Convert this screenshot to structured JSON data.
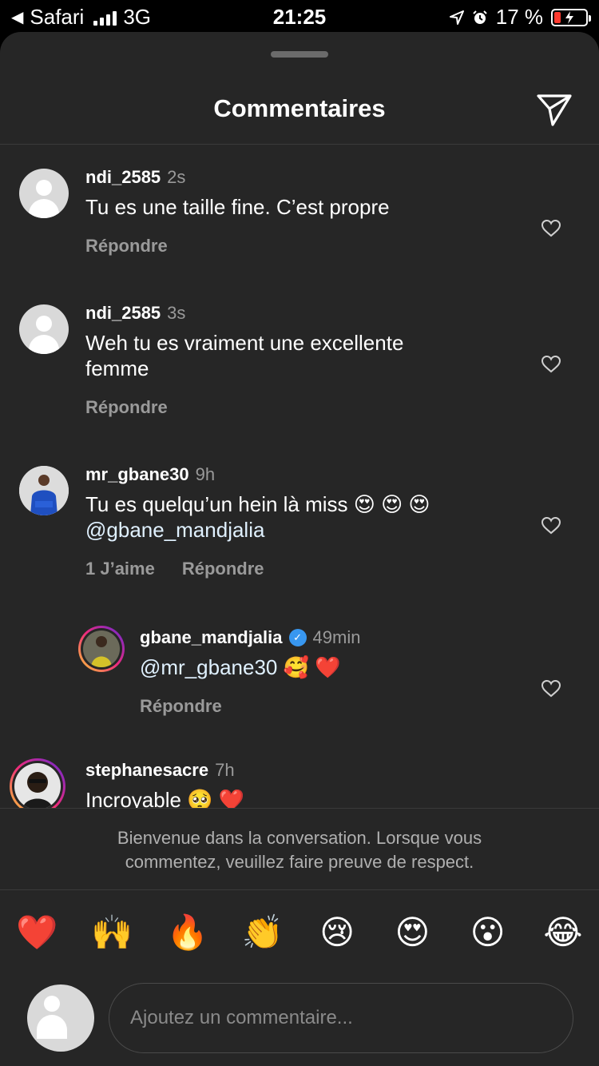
{
  "status_bar": {
    "back_app": "Safari",
    "network": "3G",
    "time": "21:25",
    "battery": "17 %"
  },
  "header": {
    "title": "Commentaires",
    "send_icon": "paper-plane-icon"
  },
  "comments": [
    {
      "username": "ndi_2585",
      "time": "2s",
      "text": "Tu es une taille fine. C’est propre",
      "reply": "Répondre",
      "avatar": "default"
    },
    {
      "username": "ndi_2585",
      "time": "3s",
      "text_lines": [
        "Weh tu es vraiment une excellente",
        "femme"
      ],
      "reply": "Répondre",
      "avatar": "default"
    },
    {
      "username": "mr_gbane30",
      "time": "9h",
      "text": "Tu es quelqu’un hein là miss 😍 😍 😍",
      "mention": "@gbane_mandjalia",
      "likes": "1 J’aime",
      "reply": "Répondre",
      "avatar": "photo"
    },
    {
      "username": "gbane_mandjalia",
      "time": "49min",
      "mention": "@mr_gbane30",
      "text_after": " 🥰 ❤️",
      "reply": "Répondre",
      "verified": true,
      "avatar": "photo"
    },
    {
      "username": "stephanesacre",
      "time": "7h",
      "text": "Incroyable 🥺 ❤️",
      "avatar": "photo"
    }
  ],
  "welcome_message": {
    "line1": "Bienvenue dans la conversation. Lorsque vous",
    "line2": "commentez, veuillez faire preuve de respect."
  },
  "quick_emojis": [
    "❤️",
    "🙌",
    "🔥",
    "👏",
    "😢",
    "😍",
    "😮",
    "😂"
  ],
  "comment_input": {
    "placeholder": "Ajoutez un commentaire..."
  },
  "colors": {
    "sheet_bg": "#262626",
    "secondary_text": "#9a9a9a",
    "verified": "#3897f0",
    "battery_low": "#ff3b30"
  }
}
